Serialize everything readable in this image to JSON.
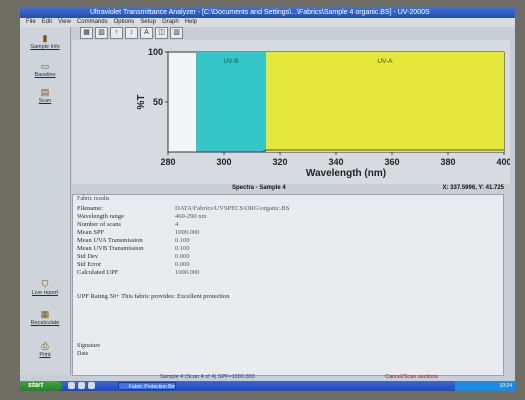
{
  "window": {
    "title": "Ultraviolet Transmittance Analyzer - [C:\\Documents and Settings\\...\\Fabrics\\Sample 4 organic.BS] - UV-2000S"
  },
  "menu": [
    "File",
    "Edit",
    "View",
    "Commands",
    "Options",
    "Setup",
    "Graph",
    "Help"
  ],
  "sidebar": [
    {
      "label": "Sample Info",
      "icon": "sample-info-icon",
      "glyph": "▮"
    },
    {
      "label": "Baseline",
      "icon": "baseline-icon",
      "glyph": "▭"
    },
    {
      "label": "Scan",
      "icon": "scan-icon",
      "glyph": "▤"
    },
    {
      "label": "Live report",
      "icon": "live-report-icon",
      "glyph": "⛉"
    },
    {
      "label": "Recalculate",
      "icon": "recalculate-icon",
      "glyph": "▦"
    },
    {
      "label": "Print",
      "icon": "print-icon",
      "glyph": "⎙"
    }
  ],
  "toolbar": [
    "▦",
    "▧",
    "↑",
    "↕",
    "A",
    "◫",
    "▥"
  ],
  "chart_data": {
    "type": "area",
    "title": "Spectra - Sample 4",
    "xlabel": "Wavelength (nm)",
    "ylabel": "%T",
    "xlim": [
      280,
      400
    ],
    "ylim": [
      0,
      100
    ],
    "xticks": [
      280,
      300,
      320,
      340,
      360,
      380,
      400
    ],
    "yticks": [
      50,
      100
    ],
    "regions": [
      {
        "name": "UV-B",
        "x": [
          290,
          315
        ],
        "color": "#33c7c9"
      },
      {
        "name": "UV-A",
        "x": [
          315,
          400
        ],
        "color": "#e5e83a"
      }
    ],
    "series": [
      {
        "x": [
          290,
          300,
          310,
          314,
          315,
          320,
          330,
          340,
          360,
          380,
          400
        ],
        "values": [
          0,
          0,
          0,
          0,
          2,
          2,
          2,
          2,
          2,
          2,
          2
        ]
      }
    ],
    "grid": false
  },
  "status": {
    "plot_title": "Spectra - Sample 4",
    "cursor": "X: 337.5996, Y: 41.725"
  },
  "results": {
    "header": "Fabric results",
    "rows": [
      {
        "k": "Filename:",
        "v": "DATA\\Fabrics\\UVSPECS\\ORG\\organic.BS"
      },
      {
        "k": "Wavelength range",
        "v": "460-290 nm"
      },
      {
        "k": "Number of scans",
        "v": "4"
      },
      {
        "k": "Mean SPF",
        "v": "1000.000"
      },
      {
        "k": "Mean UVA Transmission",
        "v": "0.100"
      },
      {
        "k": "Mean UVB Transmission",
        "v": "0.100"
      },
      {
        "k": "Std Dev",
        "v": "0.000"
      },
      {
        "k": "Std Error",
        "v": "0.000"
      },
      {
        "k": "Calculated UPF",
        "v": "1000.000"
      }
    ],
    "upf_line": "UPF Rating 50+   This fabric provides: Excellent protection",
    "signature": "Signature",
    "date": "Date"
  },
  "footer": {
    "sample": "Sample 4 (Scan 4 of 4)   SPF=1000.000",
    "cancel": "Cancel/Scan sections"
  },
  "taskbar": {
    "start": "start",
    "task": "Fabric Protection Bm",
    "clock": "10:24"
  }
}
